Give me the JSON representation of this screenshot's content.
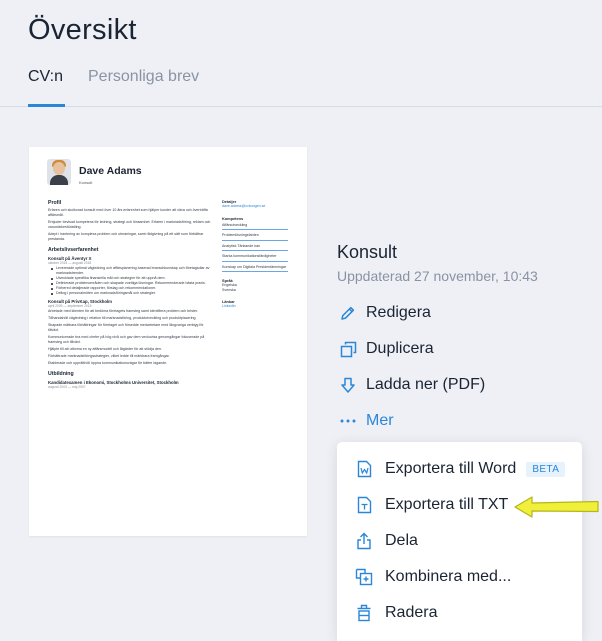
{
  "page": {
    "title": "Översikt",
    "tabs": [
      {
        "label": "CV:n",
        "active": true
      },
      {
        "label": "Personliga brev",
        "active": false
      }
    ]
  },
  "cv_preview": {
    "name": "Dave Adams",
    "subtitle": "Konsult",
    "sections": {
      "profile": {
        "title": "Profil",
        "paragraphs": [
          "Erfaren och skolkorad konsult med över 10 års erfarenhet som hjälper kunder att växa och överträffa affärsmål.",
          "Erbjuder bevisad kompetens för ledning, strategi och lönsamhet. Erfaren i marknadsföring, reklam och varumärkesförädling.",
          "Adept i hantering av komplexa problem och utmaningar, samt rådgivning på ett sätt som förbättrar prestanda."
        ]
      },
      "work": {
        "title": "Arbetslivserfarenhet",
        "jobs": [
          {
            "title": "Konsult på Åventyr X",
            "meta": "oktober 2015 — augusti 2018",
            "bullets": [
              "Levererade optimal vägledning och affärsplanering baserad branschkunskap och företagsdiar av marknadstrender.",
              "Utvecklade specifika finansiella mål och strategier för att uppnå dem.",
              "Definierade problemområden och skapade voettiga lösningar. Rekommenderade bästa praxis.",
              "Förbered detaljerade rapporter, förslag och rekommendationer.",
              "Deltog i personalmöten om marknadsföringsmål och strategier."
            ]
          },
          {
            "title": "Konsult på PrivKap, Stockholm",
            "meta": "april 2009 — september 2015",
            "paragraphs": [
              "Arbetade med klienten för att bedöma företagets framsteg samt identifiera problem och brister.",
              "Tillhandahöll vägledning i relation till marknadsföring, produktutveckling och produktplacering.",
              "Skapade mätbara förbättringar för företaget och försedde medarbetare med långvariga verktyg för tillväxt.",
              "Kommunicerade bra med chefer på hög nivå och gav dem veckovisa genomgångar fokuserade på framsteg och tillväxt.",
              "Hjälpte till att utforma en ny affärsmodell och åtgärder för att stödja den.",
              "Förbättrade marknadsföringsstrategier, vilket ledde till märkbara framgångar.",
              "Etablerade och upprätthöll öppna kommunikationsvägar för bättre lagande."
            ]
          }
        ]
      },
      "education": {
        "title": "Utbildning",
        "degree": "Kandidatexamen i Ekonomi, Stockholms Universitet, Stockholm",
        "meta": "augusti 2003 — maj 2007"
      }
    },
    "sidebar": {
      "details_title": "Detaljer",
      "email": "dave.adams@cvkungen.se",
      "skills_title": "Kompetens",
      "skills": [
        "Affärsutveckling",
        "Problemlösningsfarden",
        "Analytisk Tänkande kan",
        "Starka kommunikationsfärdigheter",
        "Kunskap om Digitala Presidentämningar"
      ],
      "languages_title": "Språk",
      "languages": [
        "Engelska",
        "Svenska"
      ],
      "links_title": "Länkar",
      "links": [
        "LinkedIn"
      ]
    }
  },
  "document": {
    "title": "Konsult",
    "updated": "Uppdaterad 27 november, 10:43"
  },
  "actions": [
    {
      "label": "Redigera",
      "icon": "pencil-icon"
    },
    {
      "label": "Duplicera",
      "icon": "duplicate-icon"
    },
    {
      "label": "Ladda ner (PDF)",
      "icon": "download-icon"
    },
    {
      "label": "Mer",
      "icon": "more-dots-icon"
    }
  ],
  "more_menu": {
    "items": [
      {
        "label": "Exportera till Word",
        "icon": "word-file-icon",
        "badge": "BETA"
      },
      {
        "label": "Exportera till TXT",
        "icon": "txt-file-icon"
      },
      {
        "label": "Dela",
        "icon": "share-icon"
      },
      {
        "label": "Kombinera med...",
        "icon": "combine-icon"
      },
      {
        "label": "Radera",
        "icon": "trash-icon"
      }
    ]
  },
  "colors": {
    "accent": "#2a86d8",
    "background": "#eef0f5",
    "arrow_fill": "#f0f03a",
    "arrow_stroke": "#b7b51a"
  }
}
